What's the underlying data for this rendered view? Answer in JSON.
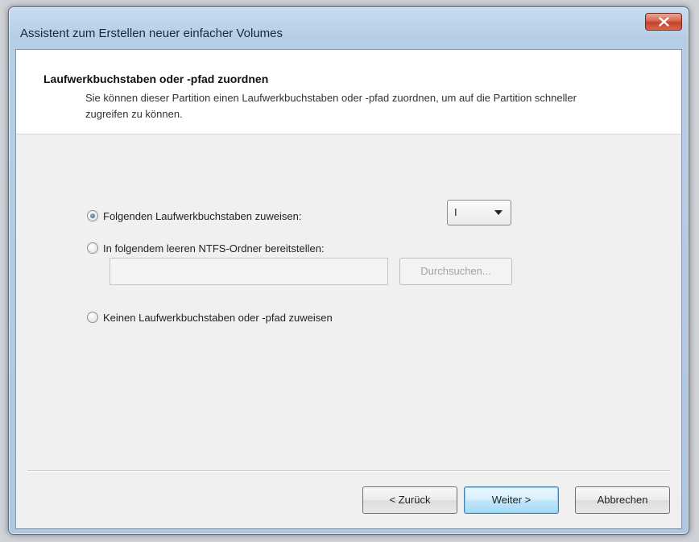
{
  "window": {
    "title": "Assistent zum Erstellen neuer einfacher Volumes"
  },
  "header": {
    "title": "Laufwerkbuchstaben oder -pfad zuordnen",
    "description": "Sie können dieser Partition einen Laufwerkbuchstaben oder -pfad zuordnen, um auf die Partition schneller zugreifen zu können."
  },
  "options": {
    "assign_letter": {
      "label": "Folgenden Laufwerkbuchstaben zuweisen:",
      "checked": true
    },
    "mount_folder": {
      "label": "In folgendem leeren NTFS-Ordner bereitstellen:",
      "checked": false
    },
    "no_letter": {
      "label": "Keinen Laufwerkbuchstaben oder -pfad zuweisen",
      "checked": false
    }
  },
  "drive_letter": {
    "selected": "I"
  },
  "folder_path": {
    "value": ""
  },
  "buttons": {
    "browse": "Durchsuchen...",
    "back": "< Zurück",
    "next": "Weiter >",
    "cancel": "Abbrechen"
  },
  "colors": {
    "close_button": "#c4412a",
    "default_button_border": "#3c7fb1",
    "title_bar": "#b6cde6"
  },
  "icons": {
    "close": "close-icon",
    "dropdown": "chevron-down-icon"
  }
}
